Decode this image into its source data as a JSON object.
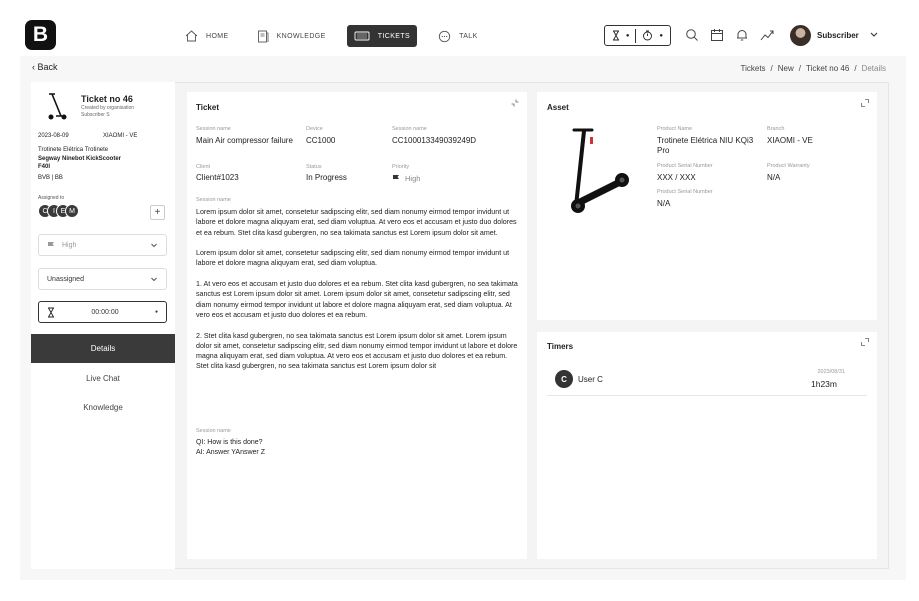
{
  "header": {
    "logo": "B",
    "nav": [
      {
        "label": "HOME",
        "icon": "home-icon"
      },
      {
        "label": "KNOWLEDGE",
        "icon": "book-icon"
      },
      {
        "label": "TICKETS",
        "icon": "ticket-icon",
        "active": true
      },
      {
        "label": "TALK",
        "icon": "chat-icon"
      }
    ],
    "user_name": "Subscriber"
  },
  "back_label": "Back",
  "breadcrumb": [
    "Tickets",
    "New",
    "Ticket no 46",
    "Details"
  ],
  "sidebar": {
    "ticket_no": "Ticket no 46",
    "created_by": "Created by organisation Subscriber S",
    "date": "2023-08-09",
    "brand": "XIAOMI - VE",
    "product_category": "Trotinete Elétrica Trotinete",
    "product_name": "Segway Ninebot KickScooter F40I",
    "serial": "BVB | BB",
    "assigned_label": "Assigned to",
    "assignees": [
      "C",
      "I",
      "E",
      "M"
    ],
    "add_label": "+",
    "priority": "High",
    "assignment": "Unassigned",
    "timer": "00:00:00",
    "tabs": [
      "Details",
      "Live Chat",
      "Knowledge"
    ]
  },
  "ticket": {
    "title": "Ticket",
    "fields": {
      "session_name_label": "Session name",
      "session_name": "Main Air compressor failure",
      "device_label": "Device",
      "device": "CC1000",
      "session_name2_label": "Session name",
      "session_name2": "CC100013349039249D",
      "client_label": "Client",
      "client": "Client#1023",
      "status_label": "Status",
      "status": "In Progress",
      "priority_label": "Priority",
      "priority": "High"
    },
    "body_label": "Session name",
    "paragraphs": [
      "Lorem ipsum dolor sit amet, consetetur sadipscing elitr, sed diam nonumy eirmod tempor invidunt ut labore et dolore magna aliquyam erat, sed diam voluptua. At vero eos et accusam et justo duo dolores et ea rebum. Stet clita kasd gubergren, no sea takimata sanctus est Lorem ipsum dolor sit amet.",
      "Lorem ipsum dolor sit amet, consetetur sadipscing elitr, sed diam nonumy eirmod tempor invidunt ut labore et dolore magna aliquyam erat, sed diam voluptua.",
      "  1. At vero eos et accusam et justo duo dolores et ea rebum. Stet clita kasd gubergren, no sea takimata sanctus est Lorem ipsum dolor sit amet. Lorem ipsum dolor sit amet, consetetur sadipscing elitr, sed diam nonumy eirmod tempor invidunt ut labore et dolore magna aliquyam erat, sed diam voluptua. At vero eos et accusam et justo duo dolores et ea rebum.",
      "  2. Stet clita kasd gubergren, no sea takimata sanctus est Lorem ipsum dolor sit amet. Lorem ipsum dolor sit amet, consetetur sadipscing elitr, sed diam nonumy eirmod tempor invidunt ut labore et dolore magna aliquyam erat, sed diam voluptua. At vero eos et accusam et justo duo dolores et ea rebum. Stet clita kasd gubergren, no sea takimata sanctus est Lorem ipsum dolor sit"
    ],
    "qa_label": "Session name",
    "question": "QI: How is this done?",
    "answer": "AI: Answer YAnswer Z"
  },
  "asset": {
    "title": "Asset",
    "product_name_label": "Product Name",
    "product_name": "Trotinete Elétrica NIU KQi3 Pro",
    "brand_label": "Branch",
    "brand": "XIAOMI - VE",
    "serial_label": "Product Serial Number",
    "serial": "XXX / XXX",
    "warranty_label": "Product Warranty",
    "warranty": "N/A",
    "serial2_label": "Product Serial Number",
    "serial2": "N/A"
  },
  "timers": {
    "title": "Timers",
    "rows": [
      {
        "initial": "C",
        "user": "User C",
        "date": "2023/08/31",
        "duration": "1h23m"
      }
    ]
  }
}
